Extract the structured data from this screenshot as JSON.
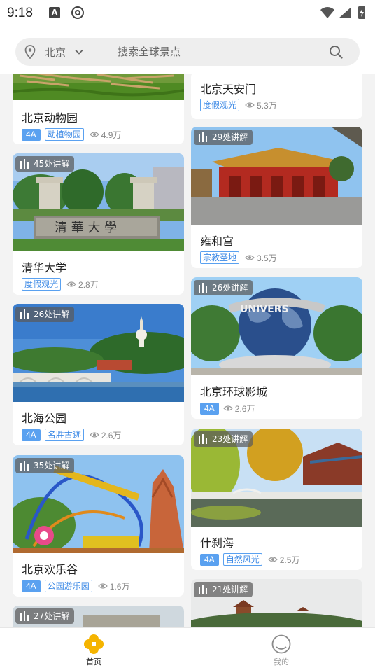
{
  "status_bar": {
    "time": "9:18"
  },
  "search": {
    "city": "北京",
    "placeholder": "搜索全球景点"
  },
  "feed": {
    "left": [
      {
        "title": "北京动物园",
        "level": "4A",
        "category": "动植物园",
        "views": "4.9万"
      },
      {
        "title": "清华大学",
        "guide_count": "45处讲解",
        "category": "度假观光",
        "views": "2.8万"
      },
      {
        "title": "北海公园",
        "guide_count": "26处讲解",
        "level": "4A",
        "category": "名胜古迹",
        "views": "2.6万"
      },
      {
        "title": "北京欢乐谷",
        "guide_count": "35处讲解",
        "level": "4A",
        "category": "公园游乐园",
        "views": "1.6万"
      },
      {
        "guide_count": "27处讲解"
      }
    ],
    "right": [
      {
        "title": "北京天安门",
        "category": "度假观光",
        "views": "5.3万"
      },
      {
        "title": "雍和宫",
        "guide_count": "29处讲解",
        "category": "宗教圣地",
        "views": "3.5万"
      },
      {
        "title": "北京环球影城",
        "guide_count": "26处讲解",
        "level": "4A",
        "views": "2.6万"
      },
      {
        "title": "什刹海",
        "guide_count": "23处讲解",
        "level": "4A",
        "category": "自然风光",
        "views": "2.5万"
      },
      {
        "guide_count": "21处讲解"
      }
    ]
  },
  "nav": {
    "home": "首页",
    "mine": "我的"
  },
  "colors": {
    "accent": "#f5b400",
    "tag_blue": "#5aa1f0"
  }
}
